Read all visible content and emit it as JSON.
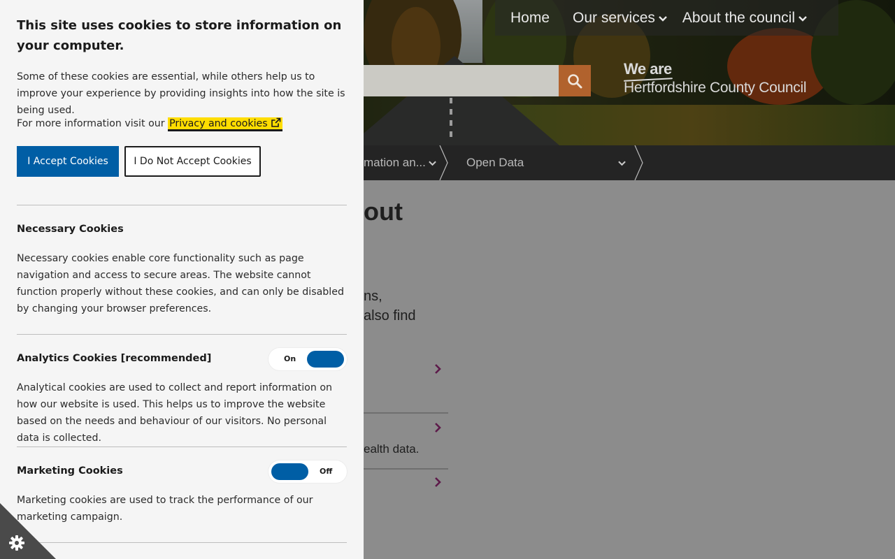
{
  "site": {
    "nav": {
      "home": "Home",
      "services": "Our services",
      "about": "About the council"
    },
    "logo": {
      "we_are": "We are",
      "council_name": "Hertfordshire County Council"
    },
    "breadcrumb": {
      "item_truncated": "mation an...",
      "open_data": "Open Data"
    },
    "page_title_fragment": "out",
    "intro_line1": "ns,",
    "intro_line2": "also find",
    "health_text": "ealth data."
  },
  "cookie_banner": {
    "title": "This site uses cookies to store information on your computer.",
    "intro": "Some of these cookies are essential, while others help us to improve your experience by providing insights into how the site is being used.",
    "more_info_prefix": "For more information visit our",
    "privacy_link": "Privacy and cookies",
    "accept_button": "I Accept Cookies",
    "reject_button": "I Do Not Accept Cookies",
    "sections": [
      {
        "title": "Necessary Cookies",
        "text": "Necessary cookies enable core functionality such as page navigation and access to secure areas. The website cannot function properly without these cookies, and can only be disabled by changing your browser preferences."
      },
      {
        "title": "Analytics Cookies [recommended]",
        "toggle_state": "On",
        "text": "Analytical cookies are used to collect and report information on how our website is used. This helps us to improve the website based on the needs and behaviour of our visitors. No personal data is collected."
      },
      {
        "title": "Marketing Cookies",
        "toggle_state": "Off",
        "text": "Marketing cookies are used to track the performance of our marketing campaign."
      }
    ]
  },
  "colors": {
    "accent_blue": "#005ea5",
    "link_highlight": "#ffdd00",
    "search_button": "#b1622d"
  }
}
